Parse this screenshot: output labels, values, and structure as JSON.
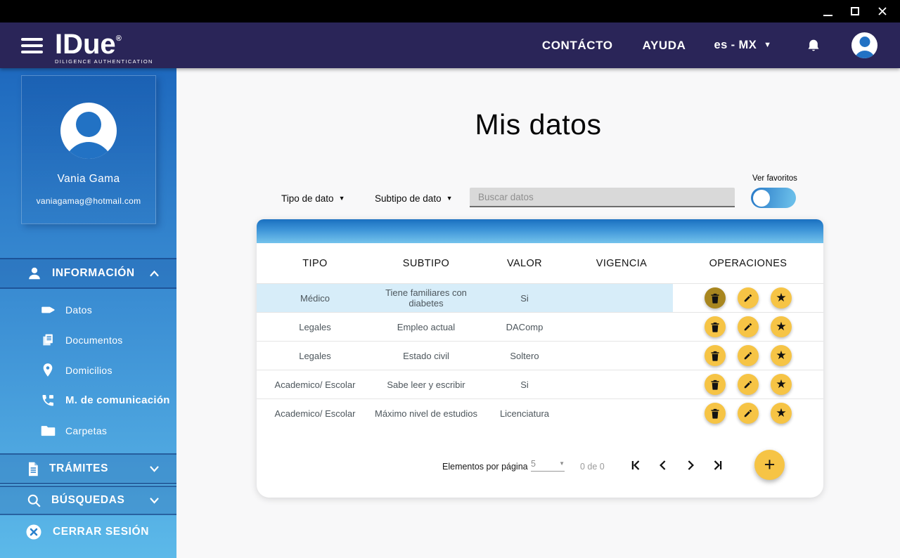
{
  "titlebar": {
    "controls": [
      "minimize",
      "maximize",
      "close"
    ]
  },
  "header": {
    "brand": "IDue",
    "registered": "®",
    "tagline": "DILIGENCE AUTHENTICATION",
    "contact_label": "CONTÁCTO",
    "help_label": "AYUDA",
    "language_label": "es - MX"
  },
  "sidebar": {
    "profile": {
      "name": "Vania Gama",
      "email": "vaniagamag@hotmail.com"
    },
    "info_section": {
      "label": "INFORMACIÓN",
      "icon": "person-icon",
      "state": "expanded"
    },
    "info_items": [
      {
        "label": "Datos",
        "icon": "tag-icon"
      },
      {
        "label": "Documentos",
        "icon": "documents-icon"
      },
      {
        "label": "Domicilios",
        "icon": "location-pin-icon"
      },
      {
        "label": "M. de comunicación",
        "icon": "phone-icon",
        "active": true
      },
      {
        "label": "Carpetas",
        "icon": "folder-icon"
      }
    ],
    "tramites_label": "TRÁMITES",
    "busquedas_label": "BÚSQUEDAS",
    "logout_label": "CERRAR SESIÓN"
  },
  "main": {
    "title": "Mis datos",
    "filters": {
      "type_label": "Tipo de dato",
      "subtype_label": "Subtipo de dato",
      "search_placeholder": "Buscar datos",
      "search_value": "",
      "favorites_label": "Ver favoritos",
      "favorites_on": false
    },
    "table": {
      "columns": [
        "TIPO",
        "SUBTIPO",
        "VALOR",
        "VIGENCIA",
        "OPERACIONES"
      ],
      "operations": [
        "delete",
        "edit",
        "favorite"
      ],
      "rows": [
        {
          "tipo": "Médico",
          "subtipo": "Tiene familiares con diabetes",
          "valor": "Si",
          "vigencia": "",
          "highlighted": true
        },
        {
          "tipo": "Legales",
          "subtipo": "Empleo actual",
          "valor": "DAComp",
          "vigencia": ""
        },
        {
          "tipo": "Legales",
          "subtipo": "Estado civil",
          "valor": "Soltero",
          "vigencia": ""
        },
        {
          "tipo": "Academico/ Escolar",
          "subtipo": "Sabe leer y escribir",
          "valor": "Si",
          "vigencia": ""
        },
        {
          "tipo": "Academico/ Escolar",
          "subtipo": "Máximo nivel de estudios",
          "valor": "Licenciatura",
          "vigencia": ""
        }
      ]
    },
    "pagination": {
      "per_page_label": "Elementos por página",
      "per_page_value": "5",
      "range_label": "0 de 0"
    }
  },
  "icons": {
    "dropdown_arrow": "▼",
    "select_arrow": "▼",
    "star": "★",
    "plus": "+"
  },
  "colors": {
    "header_navy": "#2a2558",
    "sidebar_top": "#1e69be",
    "sidebar_bottom": "#5cb9e9",
    "accent_yellow": "#f6c445",
    "accent_yellow_pressed": "#a8861f",
    "row_highlight": "#d7edf9"
  }
}
